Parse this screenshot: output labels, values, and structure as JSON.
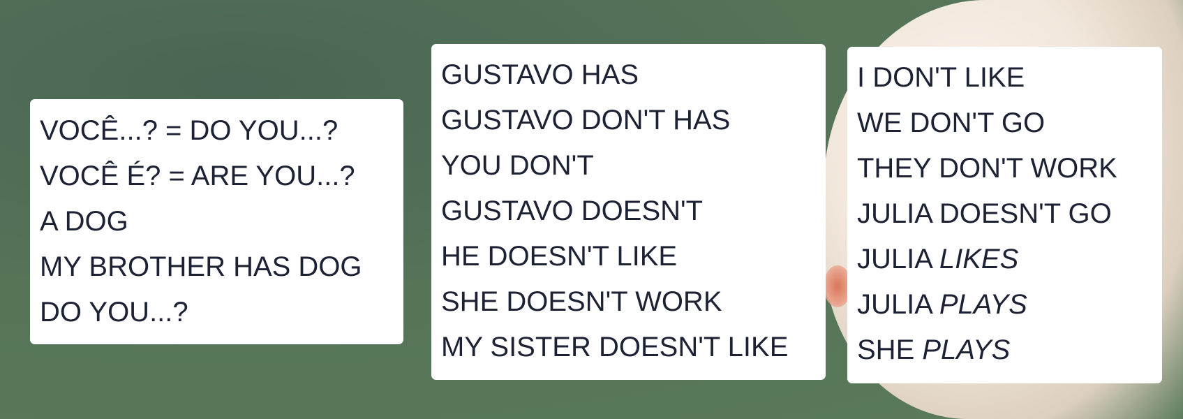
{
  "cards": [
    {
      "lines": [
        "VOCÊ...? = DO YOU...?",
        "VOCÊ É? = ARE YOU...?",
        "A DOG",
        "MY BROTHER HAS DOG",
        "DO YOU...?"
      ]
    },
    {
      "lines": [
        "GUSTAVO HAS",
        "GUSTAVO DON'T HAS",
        "YOU DON'T",
        "GUSTAVO DOESN'T",
        "HE DOESN'T LIKE",
        "SHE DOESN'T WORK",
        "MY SISTER DOESN'T LIKE"
      ]
    },
    {
      "lines": [
        {
          "plain": "I DON'T LIKE",
          "italic": ""
        },
        {
          "plain": "WE DON'T GO",
          "italic": ""
        },
        {
          "plain": "THEY DON'T WORK",
          "italic": ""
        },
        {
          "plain": "JULIA DOESN'T GO",
          "italic": ""
        },
        {
          "plain": "JULIA ",
          "italic": "LIKES"
        },
        {
          "plain": "JULIA ",
          "italic": "PLAYS"
        },
        {
          "plain": "SHE ",
          "italic": "PLAYS"
        }
      ]
    }
  ],
  "background": {
    "color": "#557458",
    "image": "white fluffy dog"
  }
}
